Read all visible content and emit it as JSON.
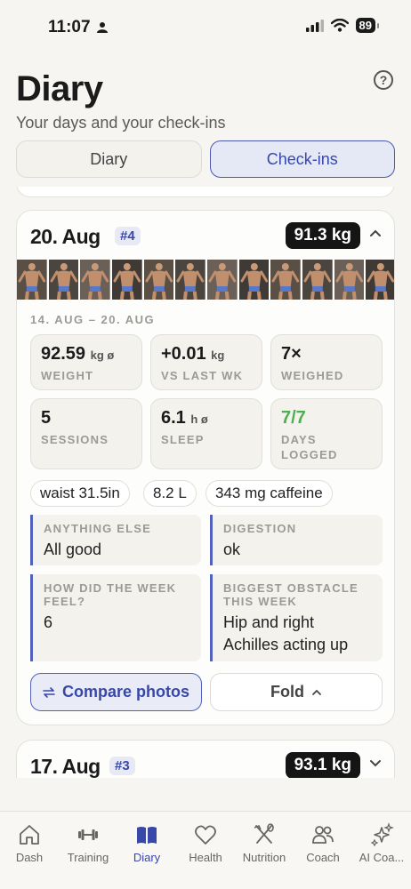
{
  "status": {
    "time": "11:07",
    "battery": "89"
  },
  "header": {
    "title": "Diary",
    "subtitle": "Your days and your check-ins",
    "help_icon": "question-circle-icon"
  },
  "segments": [
    {
      "label": "Diary",
      "active": false
    },
    {
      "label": "Check-ins",
      "active": true
    }
  ],
  "checkin": {
    "date": "20. Aug",
    "number": "#4",
    "weight": "91.3 kg",
    "photo_count": 12,
    "range": "14. AUG – 20. AUG",
    "stats": {
      "weight": {
        "value": "92.59",
        "unit": "kg ø",
        "label": "WEIGHT"
      },
      "vs_last": {
        "value": "+0.01",
        "unit": "kg",
        "label": "VS LAST WK"
      },
      "weighed": {
        "value": "7×",
        "unit": "",
        "label": "WEIGHED"
      },
      "sessions": {
        "value": "5",
        "unit": "",
        "label": "SESSIONS"
      },
      "sleep": {
        "value": "6.1",
        "unit": "h ø",
        "label": "SLEEP"
      },
      "days_logged": {
        "value": "7/7",
        "unit": "",
        "label1": "DAYS",
        "label2": "LOGGED"
      }
    },
    "chips": [
      "waist 31.5in",
      "8.2 L",
      "343 mg caffeine"
    ],
    "notes": {
      "anything_else": {
        "label": "ANYTHING ELSE",
        "value": "All good"
      },
      "digestion": {
        "label": "DIGESTION",
        "value": "ok"
      },
      "week_feel": {
        "label1": "HOW DID THE WEEK",
        "label2": "FEEL?",
        "value": "6"
      },
      "obstacle": {
        "label1": "BIGGEST OBSTACLE",
        "label2": "THIS WEEK",
        "value1": "Hip and right",
        "value2": "Achilles acting up"
      }
    },
    "buttons": {
      "compare": "Compare photos",
      "fold": "Fold"
    }
  },
  "next_checkin": {
    "date": "17. Aug",
    "number": "#3",
    "weight": "93.1 kg"
  },
  "tabs": [
    {
      "label": "Dash",
      "icon": "home-icon",
      "active": false
    },
    {
      "label": "Training",
      "icon": "dumbbell-icon",
      "active": false
    },
    {
      "label": "Diary",
      "icon": "book-icon",
      "active": true
    },
    {
      "label": "Health",
      "icon": "heart-icon",
      "active": false
    },
    {
      "label": "Nutrition",
      "icon": "utensils-icon",
      "active": false
    },
    {
      "label": "Coach",
      "icon": "people-icon",
      "active": false
    },
    {
      "label": "AI Coa...",
      "icon": "sparkles-icon",
      "active": false
    }
  ],
  "colors": {
    "accent": "#3848a8",
    "background": "#f6f5f1",
    "success": "#4caf50"
  }
}
